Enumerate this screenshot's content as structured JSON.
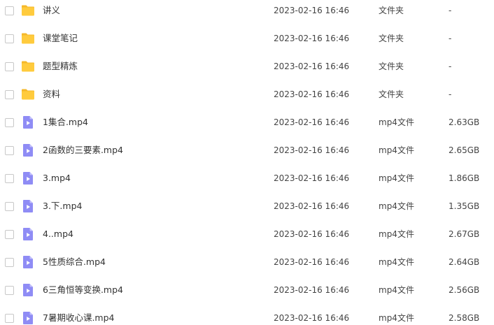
{
  "files": [
    {
      "icon": "folder-icon",
      "name": "讲义",
      "date": "2023-02-16 16:46",
      "type": "文件夹",
      "size": "-"
    },
    {
      "icon": "folder-icon",
      "name": "课堂笔记",
      "date": "2023-02-16 16:46",
      "type": "文件夹",
      "size": "-"
    },
    {
      "icon": "folder-icon",
      "name": "题型精炼",
      "date": "2023-02-16 16:46",
      "type": "文件夹",
      "size": "-"
    },
    {
      "icon": "folder-icon",
      "name": "资料",
      "date": "2023-02-16 16:46",
      "type": "文件夹",
      "size": "-"
    },
    {
      "icon": "video-file-icon",
      "name": "1集合.mp4",
      "date": "2023-02-16 16:46",
      "type": "mp4文件",
      "size": "2.63GB"
    },
    {
      "icon": "video-file-icon",
      "name": "2函数的三要素.mp4",
      "date": "2023-02-16 16:46",
      "type": "mp4文件",
      "size": "2.65GB"
    },
    {
      "icon": "video-file-icon",
      "name": "3.mp4",
      "date": "2023-02-16 16:46",
      "type": "mp4文件",
      "size": "1.86GB"
    },
    {
      "icon": "video-file-icon",
      "name": "3.下.mp4",
      "date": "2023-02-16 16:46",
      "type": "mp4文件",
      "size": "1.35GB"
    },
    {
      "icon": "video-file-icon",
      "name": "4..mp4",
      "date": "2023-02-16 16:46",
      "type": "mp4文件",
      "size": "2.67GB"
    },
    {
      "icon": "video-file-icon",
      "name": "5性质综合.mp4",
      "date": "2023-02-16 16:46",
      "type": "mp4文件",
      "size": "2.64GB"
    },
    {
      "icon": "video-file-icon",
      "name": "6三角恒等变换.mp4",
      "date": "2023-02-16 16:46",
      "type": "mp4文件",
      "size": "2.56GB"
    },
    {
      "icon": "video-file-icon",
      "name": "7暑期收心课.mp4",
      "date": "2023-02-16 16:46",
      "type": "mp4文件",
      "size": "2.58GB"
    }
  ],
  "colors": {
    "folder": "#FFCB3D",
    "folder_tab": "#F5B82A",
    "video": "#8F8CF5",
    "video_fold": "#C3C1FB",
    "checkbox_border": "#C8C8C8"
  }
}
